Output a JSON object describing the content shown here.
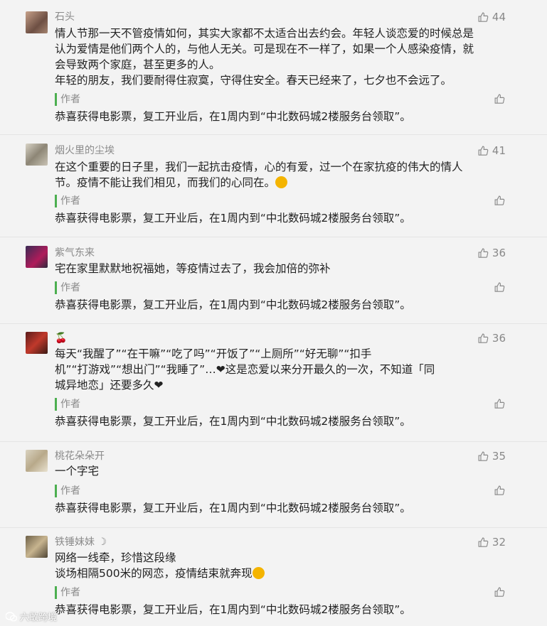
{
  "comments": [
    {
      "name": "石头",
      "likes": "44",
      "lines": [
        "情人节那一天不管疫情如何，其实大家都不太适合出去约会。年轻人谈恋爱的时候总是",
        "认为爱情是他们两个人的，与他人无关。可是现在不一样了，如果一个人感染疫情，就",
        "会导致两个家庭，甚至更多的人。",
        "年轻的朋友，我们要耐得住寂寞，守得住安全。春天已经来了，七夕也不会远了。"
      ],
      "reply_author": "作者",
      "reply_text": "恭喜获得电影票，复工开业后，在1周内到“中北数码城2楼服务台领取”。"
    },
    {
      "name": "烟火里的尘埃",
      "likes": "41",
      "lines": [
        "在这个重要的日子里，我们一起抗击疫情，心的有爱，过一个在家抗疫的伟大的情人",
        "节。疫情不能让我们相见，而我们的心同在。"
      ],
      "reply_author": "作者",
      "reply_text": "恭喜获得电影票，复工开业后，在1周内到“中北数码城2楼服务台领取”。"
    },
    {
      "name": "紫气东来",
      "likes": "36",
      "lines": [
        "宅在家里默默地祝福她，等疫情过去了，我会加倍的弥补"
      ],
      "reply_author": "作者",
      "reply_text": "恭喜获得电影票，复工开业后，在1周内到“中北数码城2楼服务台领取”。"
    },
    {
      "name": "🍒",
      "likes": "36",
      "lines": [
        "每天“我醒了”“在干嘛”“吃了吗”“开饭了”“上厕所”“好无聊”“扣手",
        "机”“打游戏”“想出门”“我睡了”…",
        "这是恋爱以来分开最久的一次，不知道「同",
        "城异地恋」还要多久"
      ],
      "reply_author": "作者",
      "reply_text": "恭喜获得电影票，复工开业后，在1周内到“中北数码城2楼服务台领取”。"
    },
    {
      "name": "桃花朵朵开",
      "likes": "35",
      "lines": [
        "一个字宅"
      ],
      "reply_author": "作者",
      "reply_text": "恭喜获得电影票，复工开业后，在1周内到“中北数码城2楼服务台领取”。"
    },
    {
      "name": "铁锤妹妹",
      "likes": "32",
      "lines": [
        "网络一线牵，珍惜这段缘",
        "谈场相隔500米的网恋，疫情结束就奔现"
      ],
      "reply_author": "作者",
      "reply_text": "恭喜获得电影票，复工开业后，在1周内到“中北数码城2楼服务台领取”。"
    }
  ],
  "watermark": "六敢跨境",
  "colors": {
    "background": "#f3f3f3",
    "reply_bar": "#4caf50",
    "muted_text": "#8a8a8a"
  }
}
